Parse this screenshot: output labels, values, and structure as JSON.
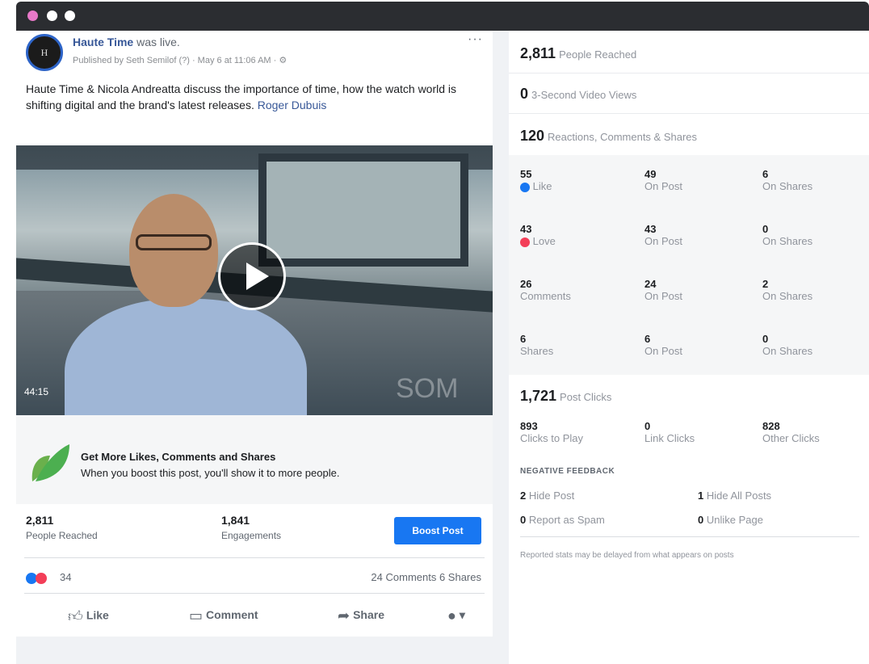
{
  "window": {
    "dots": [
      "#e879c9",
      "#ffffff",
      "#ffffff"
    ]
  },
  "post": {
    "avatar_text": "H",
    "page_name": "Haute Time",
    "action_text": "was live.",
    "meta": "Published by Seth Semilof (?) · May 6 at 11:06 AM · ⚙",
    "more": "···",
    "body": "Haute Time & Nicola Andreatta discuss the importance of time, how the watch world is shifting digital and the brand's latest releases.",
    "link": "Roger Dubuis",
    "video": {
      "duration": "44:15",
      "watermark": "SOM"
    },
    "boost": {
      "title": "Get More Likes, Comments and Shares",
      "subtitle": "When you boost this post, you'll show it to more people."
    },
    "stats": {
      "reach_value": "2,811",
      "reach_label": "People Reached",
      "engage_value": "1,841",
      "engage_label": "Engagements",
      "boost_button": "Boost Post"
    },
    "reactions": {
      "count": "34",
      "comments_shares": "24 Comments  6 Shares"
    },
    "actions": {
      "like": "Like",
      "comment": "Comment",
      "share": "Share"
    }
  },
  "insights": {
    "reach": {
      "value": "2,811",
      "label": "People Reached"
    },
    "views": {
      "value": "0",
      "label": "3-Second Video Views"
    },
    "reactions_total": {
      "value": "120",
      "label": "Reactions, Comments & Shares"
    },
    "breakdown": [
      {
        "total": "55",
        "label": "Like",
        "on_post": "49",
        "on_shares": "6"
      },
      {
        "total": "43",
        "label": "Love",
        "on_post": "43",
        "on_shares": "0"
      },
      {
        "total": "26",
        "label": "Comments",
        "on_post": "24",
        "on_shares": "2"
      },
      {
        "total": "6",
        "label": "Shares",
        "on_post": "6",
        "on_shares": "0"
      }
    ],
    "on_post_label": "On Post",
    "on_shares_label": "On Shares",
    "clicks": {
      "value": "1,721",
      "label": "Post Clicks"
    },
    "click_breakdown": [
      {
        "value": "893",
        "label": "Clicks to Play"
      },
      {
        "value": "0",
        "label": "Link Clicks"
      },
      {
        "value": "828",
        "label": "Other Clicks"
      }
    ],
    "negative_title": "NEGATIVE FEEDBACK",
    "negative": [
      {
        "value": "2",
        "label": "Hide Post"
      },
      {
        "value": "1",
        "label": "Hide All Posts"
      },
      {
        "value": "0",
        "label": "Report as Spam"
      },
      {
        "value": "0",
        "label": "Unlike Page"
      }
    ],
    "note": "Reported stats may be delayed from what appears on posts"
  },
  "colors": {
    "link": "#385898",
    "boost": "#1877f2",
    "like": "#1877f2",
    "love": "#f33e58"
  }
}
